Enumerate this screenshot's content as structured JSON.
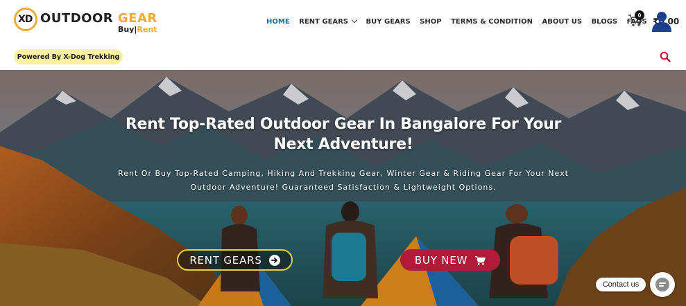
{
  "brand": {
    "logo_mark": "XD",
    "name_part1": "OUTDOOR",
    "name_part2": "GEAR",
    "tag_buy": "Buy",
    "tag_sep": "|",
    "tag_rent": "Rent",
    "accent_color": "#f2a93b"
  },
  "nav": {
    "items": [
      {
        "label": "HOME",
        "active": true
      },
      {
        "label": "RENT GEARS",
        "has_dropdown": true
      },
      {
        "label": "BUY GEARS"
      },
      {
        "label": "SHOP"
      },
      {
        "label": "TERMS & CONDITION"
      },
      {
        "label": "ABOUT US"
      },
      {
        "label": "BLOGS"
      },
      {
        "label": "FAQS"
      }
    ],
    "cart_total": "₹0.00",
    "cart_count": "0",
    "active_color": "#1a6f96",
    "cart_icon": "cart-icon",
    "account_icon": "user-icon"
  },
  "subheader": {
    "powered_by": "Powered By X-Dog Trekking",
    "search_icon": "search-icon",
    "search_color": "#c8102e"
  },
  "hero": {
    "title": "Rent Top-Rated Outdoor Gear In Bangalore For Your Next Adventure!",
    "subtitle": "Rent Or Buy Top-Rated Camping, Hiking And Trekking Gear, Winter Gear & Riding Gear For Your Next Outdoor Adventure! Guaranteed Satisfaction & Lightweight Options.",
    "rent_button": "RENT GEARS",
    "buy_button": "BUY NEW",
    "rent_border_color": "#e8d23e",
    "buy_bg_color": "#b21a3a"
  },
  "chat": {
    "contact_label": "Contact us",
    "chat_icon": "chat-icon"
  }
}
